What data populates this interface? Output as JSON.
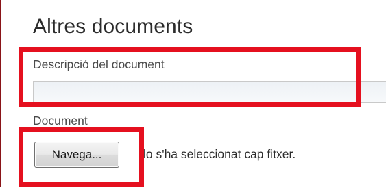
{
  "section": {
    "title": "Altres documents"
  },
  "description": {
    "label": "Descripció del document",
    "value": ""
  },
  "document": {
    "label": "Document",
    "browse_button_label": "Navega...",
    "status_text_visible": "lo s'ha seleccionat cap fitxer."
  },
  "colors": {
    "highlight": "#e5101f",
    "left_border": "#8a1418",
    "input_background": "#edf1f5"
  }
}
